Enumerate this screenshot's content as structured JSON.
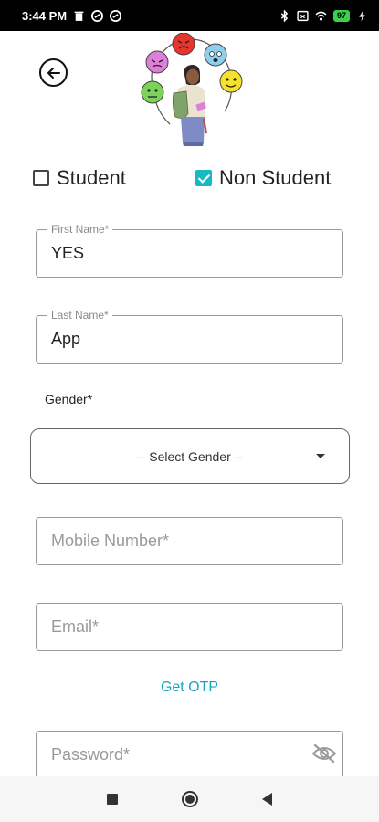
{
  "status_bar": {
    "time": "3:44 PM",
    "battery": "97"
  },
  "user_type": {
    "student_label": "Student",
    "student_checked": false,
    "non_student_label": "Non Student",
    "non_student_checked": true
  },
  "form": {
    "first_name": {
      "label": "First Name*",
      "value": "YES"
    },
    "last_name": {
      "label": "Last Name*",
      "value": "App"
    },
    "gender": {
      "label": "Gender*",
      "selected": "-- Select Gender --"
    },
    "mobile": {
      "placeholder": "Mobile Number*"
    },
    "email": {
      "placeholder": "Email*"
    },
    "otp_link": "Get OTP",
    "password": {
      "placeholder": "Password*"
    }
  },
  "colors": {
    "accent": "#19b9c3",
    "link": "#19a4bd",
    "status_bar_bg": "#000000"
  }
}
